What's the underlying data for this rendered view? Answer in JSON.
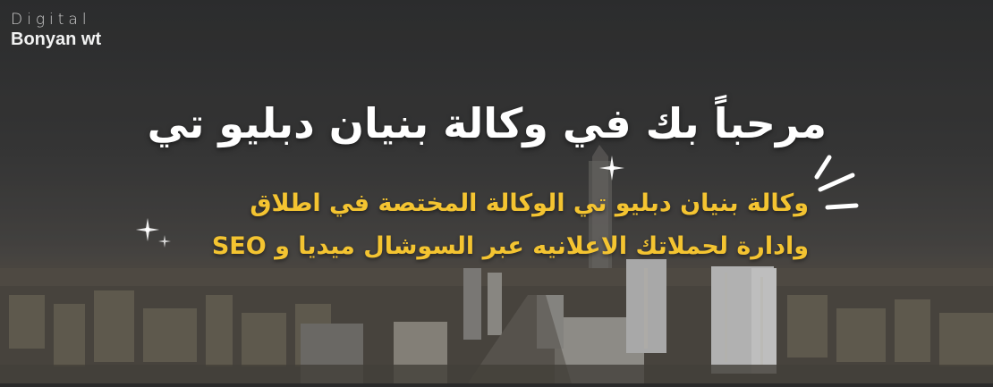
{
  "logo": {
    "top": "Digital",
    "bottom": "Bonyan wt"
  },
  "hero": {
    "headline": "مرحباً بك في وكالة بنيان دبليو تي",
    "sub_line_1": "وكالة بنيان دبليو تي الوكالة المختصة في اطلاق",
    "sub_line_2": "وادارة لحملاتك الاعلانيه عبر السوشال ميديا و SEO"
  },
  "colors": {
    "headline": "#ffffff",
    "subtext": "#f4c431",
    "overlay": "#3a3a3a"
  },
  "decorations": {
    "accent_icon": "hand-drawn-emphasis-strokes",
    "sparkle_icon": "sparkle-star"
  }
}
